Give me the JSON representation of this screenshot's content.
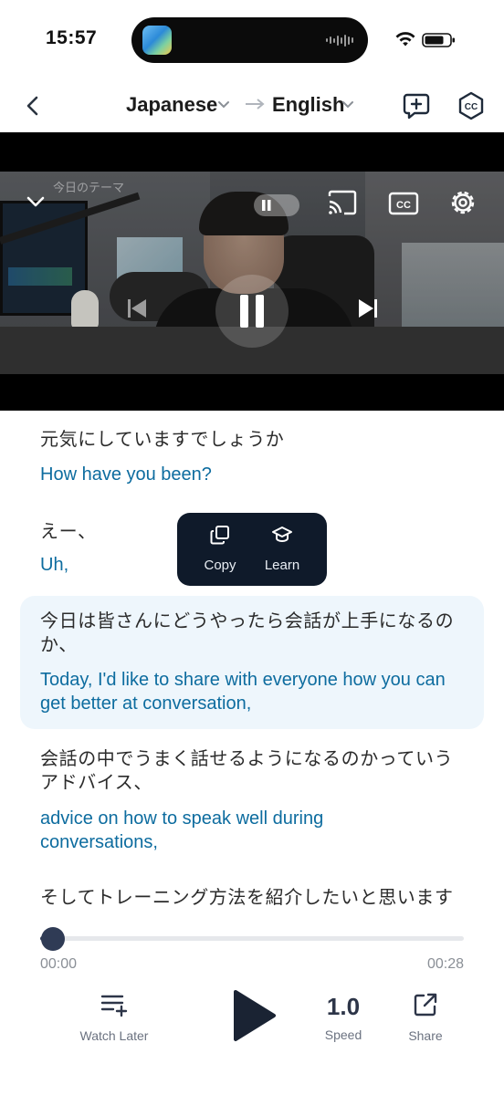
{
  "status_bar": {
    "time": "15:57"
  },
  "header": {
    "source_language": "Japanese",
    "target_language": "English"
  },
  "video": {
    "overlay_caption": "今日のテーマ"
  },
  "transcript": [
    {
      "jp": "元気にしていますでしょうか",
      "en": "How have you been?"
    },
    {
      "jp": "えー、",
      "en": "Uh,"
    },
    {
      "jp": "今日は皆さんにどうやったら会話が上手になるのか、",
      "en": "Today, I'd like to share with everyone how you can get better at conversation,"
    },
    {
      "jp": "会話の中でうまく話せるようになるのかっていうアドバイス、",
      "en": "advice on how to speak well during conversations,"
    },
    {
      "jp": "そしてトレーニング方法を紹介したいと思います",
      "en": ""
    }
  ],
  "popover": {
    "copy_label": "Copy",
    "learn_label": "Learn"
  },
  "player": {
    "current_time": "00:00",
    "duration": "00:28",
    "progress": 0.03
  },
  "bottom_bar": {
    "watch_later_label": "Watch Later",
    "speed_value": "1.0",
    "speed_label": "Speed",
    "share_label": "Share"
  },
  "colors": {
    "accent_text": "#0d6c9f",
    "highlight_bg": "#eef6fc",
    "popover_bg": "#0f1a2a",
    "progress": "#2f3b55"
  }
}
